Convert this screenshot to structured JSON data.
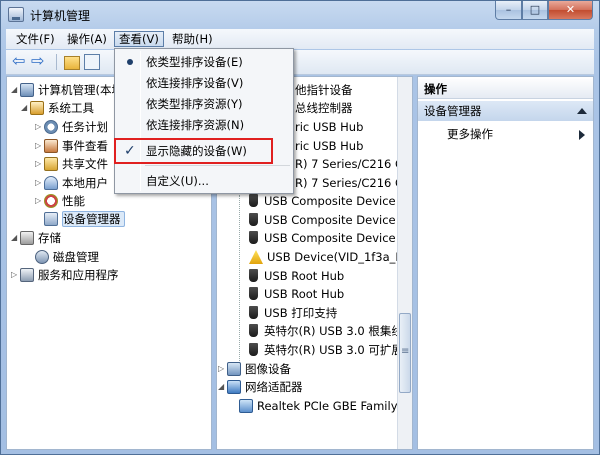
{
  "window": {
    "title": "计算机管理",
    "min_label": "–",
    "max_label": "□",
    "close_label": "✕"
  },
  "menubar": {
    "items": [
      "文件(F)",
      "操作(A)",
      "查看(V)",
      "帮助(H)"
    ]
  },
  "toolbar": {
    "back_label": "⇦",
    "forward_label": "⇨"
  },
  "left_tree": [
    {
      "label": "计算机管理(本地"
    },
    {
      "label": "系统工具"
    },
    {
      "label": "任务计划"
    },
    {
      "label": "事件查看"
    },
    {
      "label": "共享文件"
    },
    {
      "label": "本地用户"
    },
    {
      "label": "性能"
    },
    {
      "label": "设备管理器"
    },
    {
      "label": "存储"
    },
    {
      "label": "磁盘管理"
    },
    {
      "label": "服务和应用程序"
    }
  ],
  "device_tree": [
    {
      "label": "他指针设备"
    },
    {
      "label": "总线控制器"
    },
    {
      "label": "ric USB Hub"
    },
    {
      "label": "ric USB Hub"
    },
    {
      "label": "R) 7 Series/C216 Cl"
    },
    {
      "label": "R) 7 Series/C216 Cl"
    },
    {
      "label": "USB Composite Device"
    },
    {
      "label": "USB Composite Device"
    },
    {
      "label": "USB Composite Device"
    },
    {
      "label": "USB Device(VID_1f3a_PII"
    },
    {
      "label": "USB Root Hub"
    },
    {
      "label": "USB Root Hub"
    },
    {
      "label": "USB 打印支持"
    },
    {
      "label": "英特尔(R) USB 3.0 根集线"
    },
    {
      "label": "英特尔(R) USB 3.0 可扩展"
    },
    {
      "label": "图像设备"
    },
    {
      "label": "网络适配器"
    },
    {
      "label": "Realtek PCIe GBE Family"
    }
  ],
  "right_pane": {
    "header": "操作",
    "section": "设备管理器",
    "more": "更多操作"
  },
  "view_menu": {
    "items": [
      "依类型排序设备(E)",
      "依连接排序设备(V)",
      "依类型排序资源(Y)",
      "依连接排序资源(N)",
      "显示隐藏的设备(W)",
      "自定义(U)..."
    ],
    "radio_mark": "●",
    "check_mark": "✓"
  }
}
